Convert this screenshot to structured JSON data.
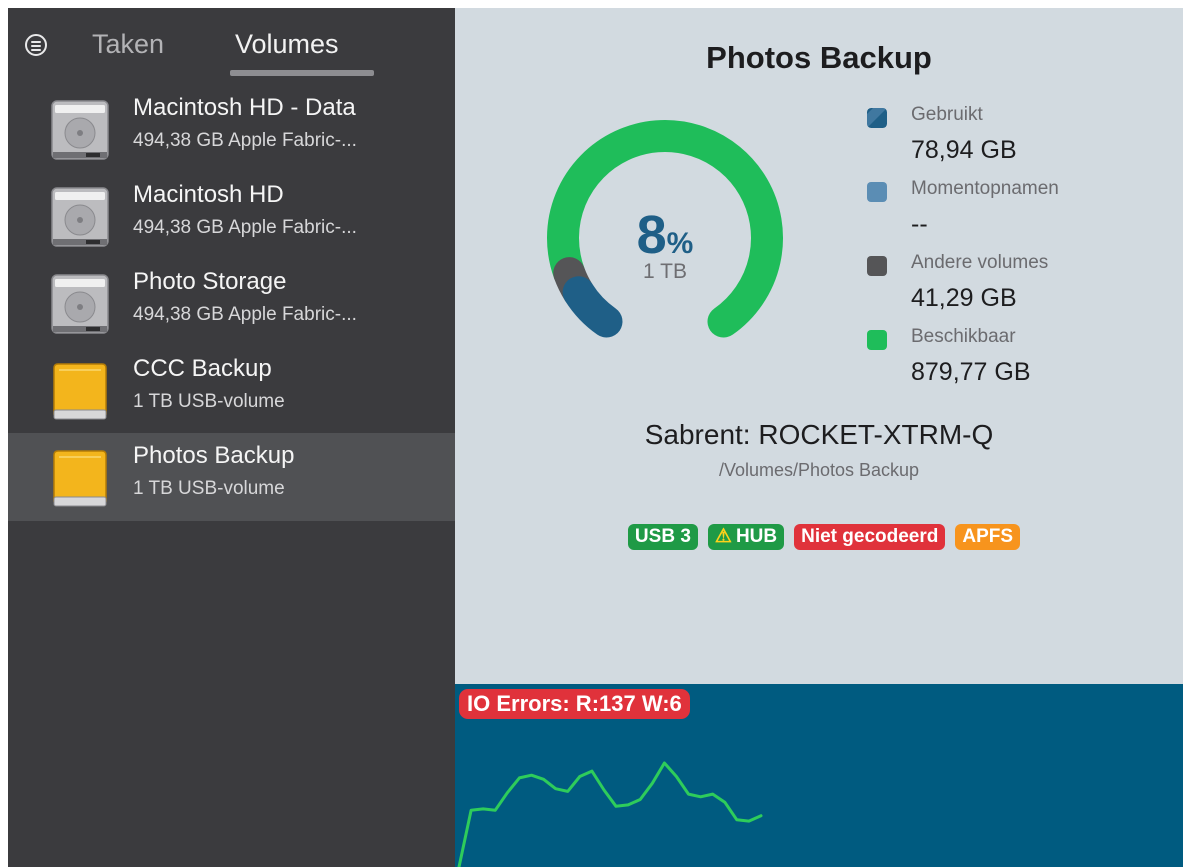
{
  "sidebar": {
    "tabs": [
      {
        "label": "Taken",
        "active": false
      },
      {
        "label": "Volumes",
        "active": true
      }
    ],
    "volumes": [
      {
        "name": "Macintosh HD - Data",
        "sub": "494,38 GB Apple Fabric-...",
        "icon": "internal-disk-icon"
      },
      {
        "name": "Macintosh HD",
        "sub": "494,38 GB Apple Fabric-...",
        "icon": "internal-disk-icon"
      },
      {
        "name": "Photo Storage",
        "sub": "494,38 GB Apple Fabric-...",
        "icon": "internal-disk-icon"
      },
      {
        "name": "CCC Backup",
        "sub": "1 TB USB-volume",
        "icon": "external-disk-icon"
      },
      {
        "name": "Photos Backup",
        "sub": "1 TB USB-volume",
        "icon": "external-disk-icon",
        "selected": true
      }
    ]
  },
  "main": {
    "title": "Photos Backup",
    "gauge": {
      "percent": "8",
      "percent_sign": "%",
      "capacity": "1 TB",
      "segments": [
        {
          "name": "Gebruikt",
          "fraction": 0.0789,
          "color": "#1f5f87"
        },
        {
          "name": "Andere volumes",
          "fraction": 0.0413,
          "color": "#555557"
        },
        {
          "name": "Beschikbaar",
          "fraction": 0.8798,
          "color": "#1fbd5a"
        }
      ]
    },
    "legend": [
      {
        "label": "Gebruikt",
        "value": "78,94 GB",
        "color": "#1f5f87"
      },
      {
        "label": "Momentopnamen",
        "value": "--",
        "color": "#5b8db4"
      },
      {
        "label": "Andere volumes",
        "value": "41,29 GB",
        "color": "#555557"
      },
      {
        "label": "Beschikbaar",
        "value": "879,77 GB",
        "color": "#1fbd5a"
      }
    ],
    "device": "Sabrent: ROCKET-XTRM-Q",
    "path": "/Volumes/Photos Backup",
    "badges": [
      {
        "label": "USB 3",
        "color": "#1f9a46"
      },
      {
        "label": "HUB",
        "warning": "⚠",
        "color": "#1f9a46"
      },
      {
        "label": "Niet gecodeerd",
        "color": "#e0323b"
      },
      {
        "label": "APFS",
        "color": "#f7941d"
      }
    ],
    "io": {
      "label": "IO Errors: R:137 W:6",
      "line_color": "#2ecc5b",
      "series": [
        0,
        42,
        43,
        42,
        55,
        66,
        68,
        65,
        58,
        56,
        67,
        71,
        57,
        45,
        46,
        50,
        62,
        77,
        67,
        54,
        52,
        54,
        48,
        35,
        34,
        38
      ]
    }
  }
}
